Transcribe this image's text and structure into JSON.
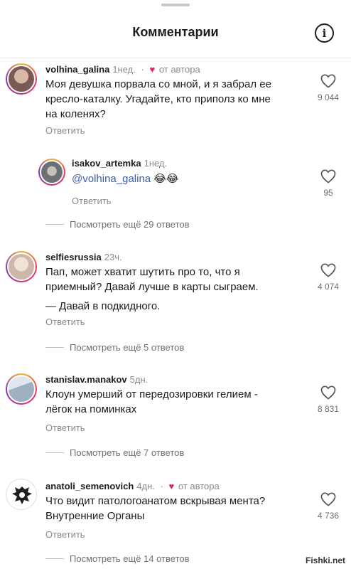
{
  "header": {
    "title": "Комментарии",
    "info_icon": "info-circle-icon"
  },
  "comments": [
    {
      "user": "volhina_galina",
      "time": "1нед.",
      "separator": "·",
      "author_like": "от автора",
      "lines": [
        "Моя девушка порвала со мной, и я забрал ее",
        "кресло-каталку. Угадайте, кто приполз ко мне",
        "на коленях?"
      ],
      "likes": "9 044",
      "reply": "Ответить",
      "avatar_color": "#7a5a55"
    },
    {
      "user": "isakov_artemka",
      "time": "1нед.",
      "mention": "@volhina_galina",
      "emoji": "😂😂",
      "likes": "95",
      "reply": "Ответить",
      "more": "Посмотреть ещё 29 ответов",
      "avatar_color": "#8c8f94"
    },
    {
      "user": "selfiesrussia",
      "time": "23ч.",
      "lines": [
        "Пап, может хватит шутить про то, что я",
        "приемный? Давай лучше в карты сыграем.",
        "— Давай в подкидного."
      ],
      "likes": "4 074",
      "reply": "Ответить",
      "more": "Посмотреть ещё 5 ответов",
      "avatar_color": "#e7d2c6"
    },
    {
      "user": "stanislav.manakov",
      "time": "5дн.",
      "lines": [
        "Клоун умерший от передозировки гелием -",
        "лёгок на поминках"
      ],
      "likes": "8 831",
      "reply": "Ответить",
      "more": "Посмотреть ещё 7 ответов",
      "avatar_color": "#b9c6d2"
    },
    {
      "user": "anatoli_semenovich",
      "time": "4дн.",
      "separator": "·",
      "author_like": "от автора",
      "lines": [
        "Что видит патологоанатом вскрывая мента?",
        "Внутренние Органы"
      ],
      "likes": "4 736",
      "reply": "Ответить",
      "more": "Посмотреть ещё 14 ответов",
      "avatar_color": "#222222"
    }
  ],
  "watermark": "Fishki.net",
  "colors": {
    "heart": "#e0245e",
    "mention": "#3b5cae",
    "muted": "#8a8a8a"
  }
}
